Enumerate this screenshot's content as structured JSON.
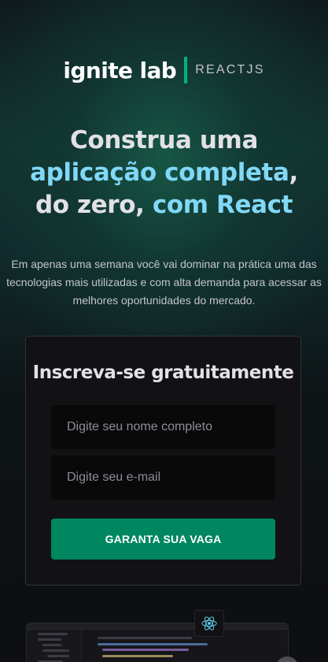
{
  "brand": {
    "name": "ignite lab",
    "product": "REACTJS",
    "accent": "#00b37e"
  },
  "hero": {
    "part1": "Construa uma ",
    "highlight1": "aplicação completa",
    "part2": ", do zero, ",
    "highlight2": "com React",
    "highlight_color": "#81d8f7",
    "description": "Em apenas uma semana você vai dominar na prática uma das tecnologias mais utilizadas e com alta demanda para acessar as melhores oportunidades do mercado."
  },
  "signup": {
    "title": "Inscreva-se gratuitamente",
    "name_placeholder": "Digite seu nome completo",
    "email_placeholder": "Digite seu e-mail",
    "submit_label": "GARANTA SUA VAGA",
    "button_color": "#00875f"
  },
  "preview": {
    "icon": "react-icon"
  }
}
